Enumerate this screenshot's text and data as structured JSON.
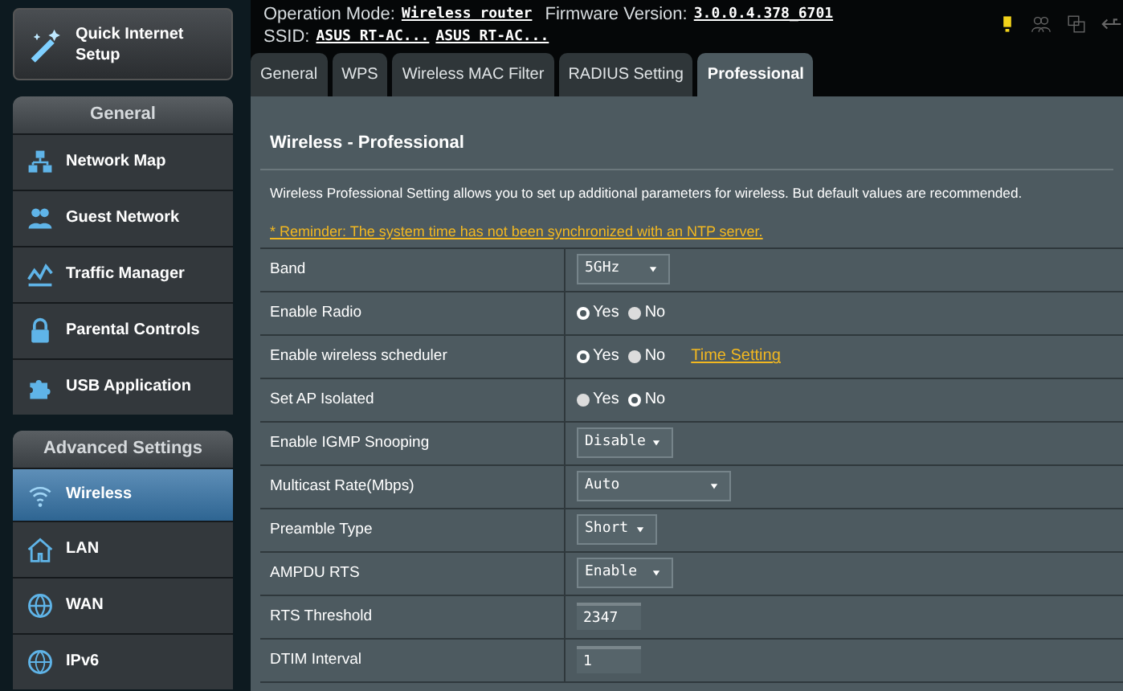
{
  "header": {
    "operation_mode_label": "Operation Mode:",
    "operation_mode": "Wireless router",
    "firmware_label": "Firmware Version:",
    "firmware": "3.0.0.4.378_6701",
    "ssid_label": "SSID:",
    "ssids": [
      "ASUS RT-AC...",
      "ASUS RT-AC..."
    ]
  },
  "quick_setup": {
    "label": "Quick Internet Setup"
  },
  "sidebar": [
    {
      "title": "General",
      "items": [
        {
          "label": "Network Map",
          "selected": false
        },
        {
          "label": "Guest Network",
          "selected": false
        },
        {
          "label": "Traffic Manager",
          "selected": false
        },
        {
          "label": "Parental Controls",
          "selected": false
        },
        {
          "label": "USB Application",
          "selected": false
        }
      ]
    },
    {
      "title": "Advanced Settings",
      "items": [
        {
          "label": "Wireless",
          "selected": true
        },
        {
          "label": "LAN",
          "selected": false
        },
        {
          "label": "WAN",
          "selected": false
        },
        {
          "label": "IPv6",
          "selected": false
        }
      ]
    }
  ],
  "tabs": [
    {
      "label": "General",
      "selected": false
    },
    {
      "label": "WPS",
      "selected": false
    },
    {
      "label": "Wireless MAC Filter",
      "selected": false
    },
    {
      "label": "RADIUS Setting",
      "selected": false
    },
    {
      "label": "Professional",
      "selected": true
    }
  ],
  "page": {
    "title": "Wireless - Professional",
    "description": "Wireless Professional Setting allows you to set up additional parameters for wireless. But default values are recommended.",
    "reminder": "* Reminder: The system time has not been synchronized with an NTP server."
  },
  "settings": [
    {
      "label": "Band",
      "kind": "select",
      "value": "5GHz"
    },
    {
      "label": "Enable Radio",
      "kind": "radio",
      "options": [
        {
          "label": "Yes",
          "selected": true
        },
        {
          "label": "No",
          "selected": false
        }
      ]
    },
    {
      "label": "Enable wireless scheduler",
      "kind": "radio",
      "options": [
        {
          "label": "Yes",
          "selected": true
        },
        {
          "label": "No",
          "selected": false
        }
      ],
      "link": "Time Setting"
    },
    {
      "label": "Set AP Isolated",
      "kind": "radio",
      "options": [
        {
          "label": "Yes",
          "selected": false
        },
        {
          "label": "No",
          "selected": true
        }
      ]
    },
    {
      "label": "Enable IGMP Snooping",
      "kind": "select",
      "value": "Disable"
    },
    {
      "label": "Multicast Rate(Mbps)",
      "kind": "select",
      "value": "Auto"
    },
    {
      "label": "Preamble Type",
      "kind": "select",
      "value": "Short"
    },
    {
      "label": "AMPDU RTS",
      "kind": "select",
      "value": "Enable"
    },
    {
      "label": "RTS Threshold",
      "kind": "input",
      "value": "2347"
    },
    {
      "label": "DTIM Interval",
      "kind": "input",
      "value": "1"
    }
  ]
}
